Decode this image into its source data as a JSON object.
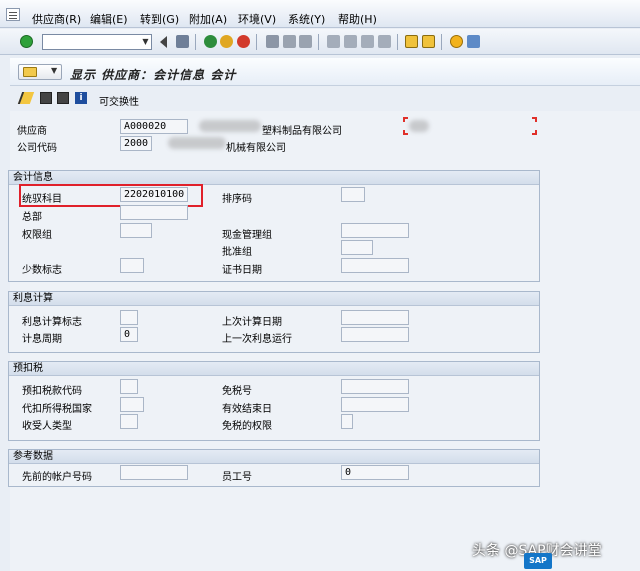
{
  "menu": {
    "items": [
      "供应商(R)",
      "编辑(E)",
      "转到(G)",
      "附加(A)",
      "环境(V)",
      "系统(Y)",
      "帮助(H)"
    ]
  },
  "toolbar": {
    "command_value": ""
  },
  "title": {
    "text": "显示 供应商：会计信息 会计"
  },
  "app_toolbar": {
    "switch_label": "可交换性"
  },
  "header": {
    "vendor_label": "供应商",
    "vendor_value": "A000020",
    "vendor_name_visible": "塑料制品有限公司",
    "company_label": "公司代码",
    "company_value": "2000",
    "company_name_visible": "机械有限公司"
  },
  "accounting": {
    "title": "会计信息",
    "recon_label": "统驭科目",
    "recon_value": "2202010100",
    "head_office_label": "总部",
    "sort_key_label": "排序码",
    "auth_group_label": "权限组",
    "cash_mgmt_label": "现金管理组",
    "approval_group_label": "批准组",
    "minority_label": "少数标志",
    "cert_date_label": "证书日期"
  },
  "interest": {
    "title": "利息计算",
    "indicator_label": "利息计算标志",
    "last_key_date_label": "上次计算日期",
    "cycle_label": "计息周期",
    "cycle_value": "0",
    "last_run_label": "上一次利息运行"
  },
  "withholding": {
    "title": "预扣税",
    "code_label": "预扣税款代码",
    "exempt_num_label": "免税号",
    "country_label": "代扣所得税国家",
    "valid_until_label": "有效结束日",
    "recipient_label": "收受人类型",
    "exempt_auth_label": "免税的权限"
  },
  "reference": {
    "title": "参考数据",
    "prev_account_label": "先前的帐户号码",
    "personnel_label": "员工号",
    "personnel_value": "0"
  },
  "watermark": {
    "text": "头条 @SAP财会讲堂",
    "logo": "SAP"
  },
  "colors": {
    "highlight": "#e0202a",
    "group_border": "#a9b8cc"
  }
}
